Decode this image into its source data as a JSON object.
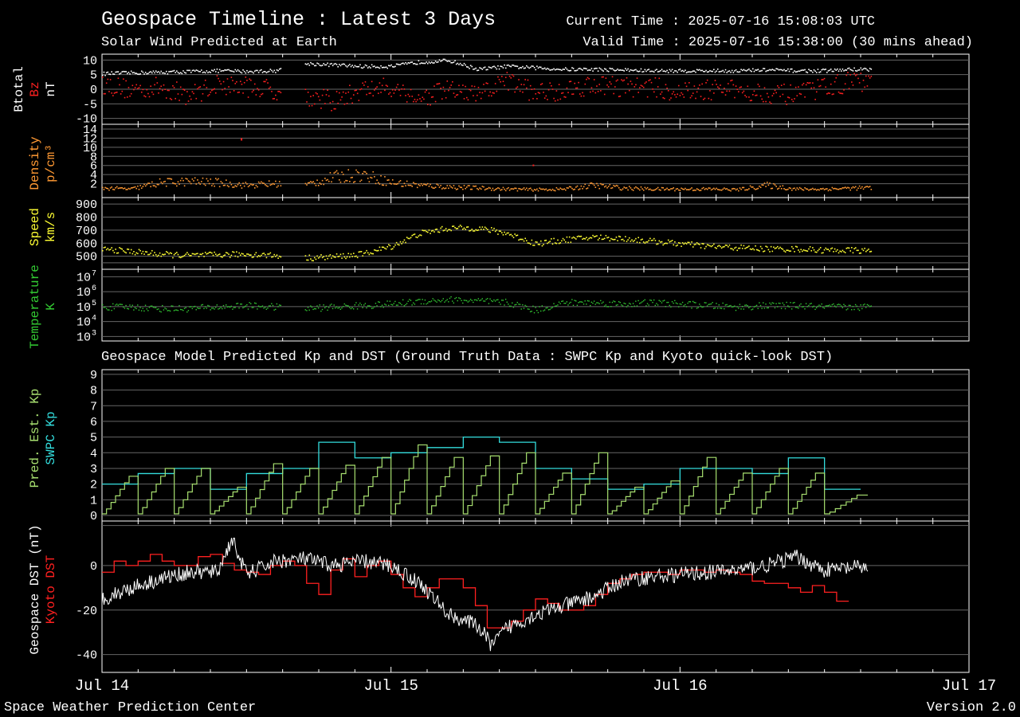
{
  "header": {
    "title": "Geospace Timeline : Latest 3 Days",
    "subtitle": "Solar Wind Predicted at Earth",
    "current_time": "Current Time : 2025-07-16 15:08:03 UTC",
    "valid_time": "Valid Time : 2025-07-16 15:38:00 (30 mins ahead)"
  },
  "kp_dst_title": "Geospace Model Predicted Kp and DST (Ground Truth Data : SWPC Kp and Kyoto quick-look DST)",
  "footer": {
    "left": "Space Weather Prediction Center",
    "right": "Version 2.0"
  },
  "colors": {
    "background": "#000000",
    "btotal": "#ffffff",
    "bz": "#ff2020",
    "density": "#ff9933",
    "speed": "#ffff33",
    "temperature": "#33cc33",
    "pred_kp": "#a8e070",
    "swpc_kp": "#33dddd",
    "geospace_dst": "#ffffff",
    "kyoto_dst": "#ff2020",
    "grid": "#666666"
  },
  "chart_data": [
    {
      "type": "scatter",
      "panel": "magnetic-field",
      "ylabels": [
        "Btotal",
        "Bz",
        "nT"
      ],
      "yticks": [
        "10",
        "5",
        "0",
        "-5",
        "-10"
      ],
      "ylim": [
        -12,
        12
      ],
      "series": [
        {
          "name": "Btotal",
          "x": [
            0,
            0.1,
            0.2,
            0.3,
            0.4,
            0.5,
            0.6,
            0.7,
            0.8,
            0.9,
            1.0,
            1.1,
            1.2,
            1.3,
            1.4,
            1.5,
            1.6,
            1.7,
            1.8,
            1.9,
            2.0,
            2.1,
            2.2,
            2.3,
            2.4,
            2.5,
            2.6,
            2.65
          ],
          "y": [
            5.5,
            5.8,
            6,
            6.2,
            6.5,
            6.3,
            6.5,
            9,
            8.5,
            8,
            8,
            9.5,
            10,
            7,
            8,
            7.5,
            7,
            7,
            6.8,
            6.5,
            6.5,
            6.5,
            6.5,
            6.8,
            6.5,
            6.5,
            7,
            7
          ]
        },
        {
          "name": "Bz",
          "x": [
            0,
            0.1,
            0.2,
            0.3,
            0.4,
            0.5,
            0.6,
            0.7,
            0.8,
            0.9,
            1.0,
            1.1,
            1.2,
            1.3,
            1.4,
            1.5,
            1.6,
            1.7,
            1.8,
            1.9,
            2.0,
            2.1,
            2.2,
            2.3,
            2.4,
            2.5,
            2.6,
            2.65
          ],
          "y": [
            2,
            0,
            1,
            -2,
            2,
            1,
            0,
            -2,
            -4,
            0,
            1,
            -3,
            0,
            -2,
            3,
            -1,
            0,
            2,
            1,
            1,
            -1,
            0,
            0,
            -1,
            -2,
            1,
            3,
            2
          ]
        }
      ]
    },
    {
      "type": "scatter",
      "panel": "density",
      "ylabels": [
        "Density",
        "p/cm³"
      ],
      "yticks": [
        "14",
        "12",
        "10",
        "8",
        "6",
        "4",
        "2"
      ],
      "ylim": [
        0,
        14
      ],
      "series": [
        {
          "name": "Density",
          "x": [
            0,
            0.1,
            0.2,
            0.3,
            0.4,
            0.5,
            0.6,
            0.7,
            0.8,
            0.9,
            1.0,
            1.1,
            1.2,
            1.3,
            1.4,
            1.5,
            1.6,
            1.7,
            1.8,
            1.9,
            2.0,
            2.1,
            2.2,
            2.3,
            2.4,
            2.5,
            2.6,
            2.65
          ],
          "y": [
            1,
            0.8,
            2,
            2.2,
            2,
            1.5,
            1.8,
            1.5,
            3,
            3.5,
            2,
            1.5,
            1.2,
            1,
            0.8,
            0.7,
            0.8,
            1.5,
            1,
            0.8,
            0.8,
            0.8,
            0.7,
            1.5,
            0.8,
            0.8,
            1,
            1
          ]
        }
      ]
    },
    {
      "type": "scatter",
      "panel": "speed",
      "ylabels": [
        "Speed",
        "km/s"
      ],
      "yticks": [
        "900",
        "800",
        "700",
        "600",
        "500"
      ],
      "ylim": [
        400,
        950
      ],
      "series": [
        {
          "name": "Speed",
          "x": [
            0,
            0.1,
            0.2,
            0.3,
            0.4,
            0.5,
            0.6,
            0.7,
            0.8,
            0.9,
            1.0,
            1.1,
            1.2,
            1.3,
            1.4,
            1.5,
            1.6,
            1.7,
            1.8,
            1.9,
            2.0,
            2.1,
            2.2,
            2.3,
            2.4,
            2.5,
            2.6,
            2.65
          ],
          "y": [
            560,
            540,
            520,
            510,
            515,
            520,
            510,
            490,
            500,
            520,
            580,
            680,
            720,
            720,
            680,
            600,
            630,
            650,
            640,
            620,
            600,
            580,
            570,
            560,
            560,
            550,
            550,
            545
          ]
        }
      ]
    },
    {
      "type": "scatter",
      "panel": "temperature",
      "ylabels": [
        "Temperature",
        "K"
      ],
      "yticks": [
        "10^7",
        "10^6",
        "10^5",
        "10^4",
        "10^3"
      ],
      "ylim_log10": [
        2.7,
        7.5
      ],
      "series": [
        {
          "name": "Temperature",
          "x": [
            0,
            0.1,
            0.2,
            0.3,
            0.4,
            0.5,
            0.6,
            0.7,
            0.8,
            0.9,
            1.0,
            1.1,
            1.2,
            1.3,
            1.4,
            1.5,
            1.6,
            1.7,
            1.8,
            1.9,
            2.0,
            2.1,
            2.2,
            2.3,
            2.4,
            2.5,
            2.6,
            2.65
          ],
          "log10_y": [
            5.0,
            5.0,
            4.9,
            4.9,
            5.0,
            5.1,
            5.0,
            4.9,
            5.0,
            5.1,
            5.2,
            5.4,
            5.5,
            5.4,
            5.3,
            4.8,
            5.3,
            5.3,
            5.2,
            5.3,
            5.2,
            5.1,
            5.0,
            5.1,
            5.1,
            5.0,
            5.0,
            5.0
          ]
        }
      ]
    },
    {
      "type": "line",
      "panel": "kp",
      "ylabels": [
        "Pred. Est. Kp",
        "SWPC Kp"
      ],
      "yticks": [
        "9",
        "8",
        "7",
        "6",
        "5",
        "4",
        "3",
        "2",
        "1",
        "0"
      ],
      "ylim": [
        0,
        9.3
      ],
      "swpc_kp": {
        "name": "SWPC Kp",
        "x_start": [
          0,
          0.125,
          0.25,
          0.375,
          0.5,
          0.625,
          0.75,
          0.875,
          1.0,
          1.125,
          1.25,
          1.375,
          1.5,
          1.625,
          1.75,
          1.875,
          2.0,
          2.125,
          2.25,
          2.375,
          2.5
        ],
        "values": [
          2,
          2.67,
          3,
          1.67,
          2.67,
          3,
          4.67,
          3.67,
          4,
          4.33,
          5,
          4.67,
          3,
          2.33,
          1.67,
          2,
          3,
          3,
          2.67,
          3.67,
          1.67
        ],
        "x_end": 2.625
      },
      "pred_kp": {
        "name": "Pred. Est. Kp",
        "x_start": [
          0,
          0.125,
          0.25,
          0.375,
          0.5,
          0.625,
          0.75,
          0.875,
          1.0,
          1.125,
          1.25,
          1.375,
          1.5,
          1.625,
          1.75,
          1.875,
          2.0,
          2.125,
          2.25,
          2.375,
          2.5
        ],
        "peak": [
          2.5,
          3,
          3,
          1.8,
          3.3,
          3,
          3.2,
          3.7,
          4.5,
          3.7,
          3.8,
          4,
          2.7,
          4,
          1.8,
          2.2,
          3.7,
          2.7,
          3,
          2.7,
          1.3
        ],
        "x_end": 2.65
      }
    },
    {
      "type": "line",
      "panel": "dst",
      "ylabels": [
        "Geospace DST (nT)",
        "Kyoto DST"
      ],
      "yticks": [
        "0",
        "-20",
        "-40"
      ],
      "ylim": [
        -48,
        20
      ],
      "series": [
        {
          "name": "Geospace DST",
          "x": [
            0,
            0.1,
            0.2,
            0.3,
            0.4,
            0.45,
            0.5,
            0.6,
            0.7,
            0.8,
            0.9,
            1.0,
            1.1,
            1.2,
            1.3,
            1.35,
            1.4,
            1.5,
            1.6,
            1.7,
            1.8,
            1.9,
            2.0,
            2.1,
            2.2,
            2.3,
            2.4,
            2.5,
            2.6,
            2.65
          ],
          "y": [
            -15,
            -10,
            -6,
            -3,
            -3,
            12,
            -4,
            2,
            3,
            0,
            2,
            0,
            -8,
            -22,
            -27,
            -36,
            -28,
            -22,
            -18,
            -14,
            -7,
            -5,
            -4,
            -3,
            -2,
            0,
            4,
            -2,
            -1,
            -1
          ]
        },
        {
          "name": "Kyoto DST",
          "x_start": [
            0,
            0.042,
            0.083,
            0.125,
            0.167,
            0.208,
            0.25,
            0.292,
            0.333,
            0.375,
            0.417,
            0.458,
            0.5,
            0.542,
            0.583,
            0.625,
            0.667,
            0.708,
            0.75,
            0.792,
            0.833,
            0.875,
            0.917,
            0.958,
            1.0,
            1.042,
            1.083,
            1.125,
            1.167,
            1.208,
            1.25,
            1.292,
            1.333,
            1.375,
            1.417,
            1.458,
            1.5,
            1.542,
            1.583,
            1.625,
            1.667,
            1.708,
            1.75,
            1.792,
            1.833,
            1.875,
            1.917,
            1.958,
            2.0,
            2.042,
            2.083,
            2.125,
            2.167,
            2.208,
            2.25,
            2.292,
            2.333,
            2.375,
            2.417,
            2.458,
            2.5,
            2.542
          ],
          "values": [
            -3,
            2,
            0,
            2,
            5,
            2,
            0,
            0,
            4,
            5,
            1,
            -2,
            -3,
            -4,
            0,
            2,
            0,
            -8,
            -13,
            -2,
            3,
            -5,
            0,
            2,
            -4,
            -10,
            -14,
            -10,
            -6,
            -6,
            -10,
            -18,
            -28,
            -28,
            -25,
            -20,
            -15,
            -17,
            -20,
            -20,
            -18,
            -13,
            -8,
            -6,
            -4,
            -3,
            -3,
            -4,
            -2,
            -2,
            -3,
            -2,
            -3,
            -4,
            -7,
            -8,
            -8,
            -10,
            -12,
            -9,
            -12,
            -16
          ]
        }
      ]
    }
  ],
  "x_axis": {
    "tick_labels": [
      "Jul 14",
      "Jul 15",
      "Jul 16",
      "Jul 17"
    ],
    "tick_values_days": [
      0,
      1,
      2,
      3
    ]
  }
}
